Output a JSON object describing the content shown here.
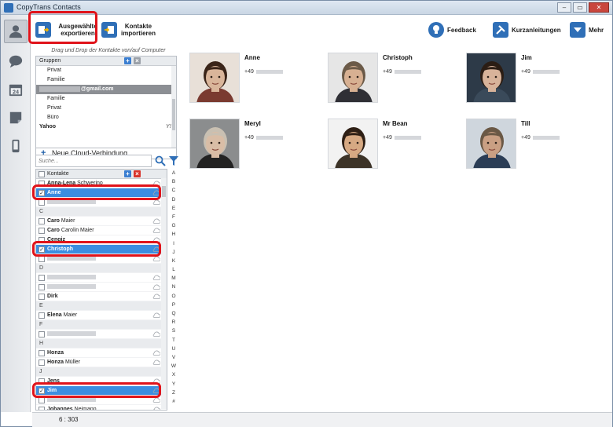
{
  "window": {
    "title": "CopyTrans Contacts",
    "controls": [
      "–",
      "▭",
      "✕"
    ]
  },
  "toolbar": {
    "export_label": "Ausgewählte exportieren",
    "import_label": "Kontakte importieren",
    "feedback_label": "Feedback",
    "guides_label": "Kurzanleitungen",
    "more_label": "Mehr"
  },
  "groups": {
    "hint": "Drag und Drop der Kontakte von/auf Computer",
    "header": "Gruppen",
    "items": [
      {
        "label": "Privat",
        "type": "group"
      },
      {
        "label": "Familie",
        "type": "group"
      },
      {
        "label": "@gmail.com",
        "type": "account"
      },
      {
        "label": "Familie",
        "type": "group"
      },
      {
        "label": "Privat",
        "type": "group"
      },
      {
        "label": "Büro",
        "type": "group"
      },
      {
        "label": "Yahoo",
        "type": "account-yahoo"
      }
    ],
    "yahoo_mark": "Y!",
    "new_cloud": "Neue Cloud-Verbindung"
  },
  "search": {
    "placeholder": "Suche..."
  },
  "contacts": {
    "header": "Kontakte",
    "rows": [
      {
        "first": "Anna-Lena",
        "last": "Schwerino",
        "type": "contact",
        "checked": false,
        "selected": false
      },
      {
        "first": "Anne",
        "last": "",
        "type": "contact",
        "checked": true,
        "selected": true
      },
      {
        "first": "",
        "last": "",
        "type": "blurred",
        "checked": false,
        "selected": false
      },
      {
        "first": "C",
        "last": "",
        "type": "section"
      },
      {
        "first": "Caro",
        "last": "Maier",
        "type": "contact",
        "checked": false,
        "selected": false
      },
      {
        "first": "Caro",
        "last": "Carolin Maier",
        "type": "contact",
        "checked": false,
        "selected": false
      },
      {
        "first": "Cengiz",
        "last": "",
        "type": "contact",
        "checked": false,
        "selected": false
      },
      {
        "first": "Christoph",
        "last": "",
        "type": "contact",
        "checked": true,
        "selected": true
      },
      {
        "first": "",
        "last": "",
        "type": "blurred",
        "checked": false,
        "selected": false
      },
      {
        "first": "D",
        "last": "",
        "type": "section"
      },
      {
        "first": "",
        "last": "",
        "type": "blurred",
        "checked": false,
        "selected": false
      },
      {
        "first": "",
        "last": "",
        "type": "blurred",
        "checked": false,
        "selected": false
      },
      {
        "first": "Dirk",
        "last": "",
        "type": "contact",
        "checked": false,
        "selected": false
      },
      {
        "first": "E",
        "last": "",
        "type": "section"
      },
      {
        "first": "Elena",
        "last": "Maier",
        "type": "contact",
        "checked": false,
        "selected": false
      },
      {
        "first": "F",
        "last": "",
        "type": "section"
      },
      {
        "first": "",
        "last": "",
        "type": "blurred",
        "checked": false,
        "selected": false
      },
      {
        "first": "H",
        "last": "",
        "type": "section"
      },
      {
        "first": "Honza",
        "last": "",
        "type": "contact",
        "checked": false,
        "selected": false
      },
      {
        "first": "Honza",
        "last": "Müller",
        "type": "contact",
        "checked": false,
        "selected": false
      },
      {
        "first": "J",
        "last": "",
        "type": "section"
      },
      {
        "first": "Jens",
        "last": "",
        "type": "contact",
        "checked": false,
        "selected": false
      },
      {
        "first": "Jim",
        "last": "",
        "type": "contact",
        "checked": true,
        "selected": true
      },
      {
        "first": "",
        "last": "",
        "type": "blurred",
        "checked": false,
        "selected": false
      },
      {
        "first": "Johannes",
        "last": "Neimann",
        "type": "contact",
        "checked": false,
        "selected": false
      }
    ],
    "alphabet": [
      "A",
      "B",
      "C",
      "D",
      "E",
      "F",
      "G",
      "H",
      "I",
      "J",
      "K",
      "L",
      "M",
      "N",
      "O",
      "P",
      "Q",
      "R",
      "S",
      "T",
      "U",
      "V",
      "W",
      "X",
      "Y",
      "Z",
      "#"
    ]
  },
  "status": {
    "count": "6 : 303"
  },
  "cards": [
    {
      "name": "Anne",
      "phone": "+49",
      "skin": "#d9b59a",
      "hair": "#3a2418",
      "shirt": "#7a3a30",
      "bg": "#e8e0d8"
    },
    {
      "name": "Christoph",
      "phone": "+49",
      "skin": "#d7b092",
      "hair": "#6b5a48",
      "shirt": "#2f2f35",
      "bg": "#e6e6e6"
    },
    {
      "name": "Jim",
      "phone": "+49",
      "skin": "#d8b39a",
      "hair": "#2b1d14",
      "shirt": "#3a4a5a",
      "bg": "#2d3a48"
    },
    {
      "name": "Meryl",
      "phone": "+49",
      "skin": "#d9bda6",
      "hair": "#c9c0b2",
      "shirt": "#222",
      "bg": "#8b8d8e"
    },
    {
      "name": "Mr Bean",
      "phone": "+49",
      "skin": "#d6a983",
      "hair": "#2e1f15",
      "shirt": "#3c3328",
      "bg": "#f2f2f2"
    },
    {
      "name": "Till",
      "phone": "+49",
      "skin": "#c99f83",
      "hair": "#6a5845",
      "shirt": "#2b3d55",
      "bg": "#cfd6dd"
    }
  ]
}
